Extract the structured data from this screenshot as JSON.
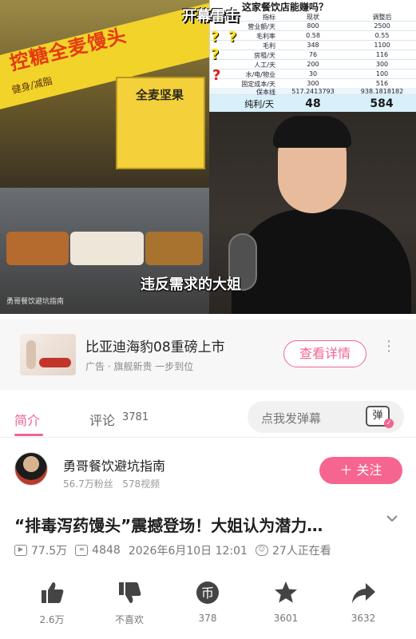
{
  "video": {
    "headline": "开幕雷击",
    "subtitle": "违反需求的大姐",
    "shop_title": "控糖全麦馒头",
    "shop_sub": "健身/减脂",
    "shop_board": "全麦坚果",
    "watermark": "勇哥餐饮避坑指南",
    "table": {
      "title": "这家餐饮店能赚吗？",
      "header": [
        "指标",
        "现状",
        "调整后"
      ],
      "rows": [
        [
          "营业额/天",
          "800",
          "2500"
        ],
        [
          "毛利率",
          "0.58",
          "0.55"
        ],
        [
          "毛利",
          "348",
          "1100"
        ],
        [
          "房租/天",
          "76",
          "116"
        ],
        [
          "人工/天",
          "200",
          "300"
        ],
        [
          "水/电/物业",
          "30",
          "100"
        ],
        [
          "固定成本/天",
          "300",
          "516"
        ],
        [
          "保本线",
          "517.2413793",
          "938.1818182"
        ]
      ],
      "result": [
        "纯利/天",
        "48",
        "584"
      ]
    },
    "question_marks": [
      "?",
      "?",
      "?",
      "?"
    ]
  },
  "ad": {
    "title": "比亚迪海豹08重磅上市",
    "sub": "广告 · 旗舰新贵 一步到位",
    "button": "查看详情",
    "more": "⋮"
  },
  "tabs": {
    "intro": "简介",
    "comments": "评论",
    "comment_count": "3781",
    "danmu_placeholder": "点我发弹幕",
    "danmu_icon_label": "弹"
  },
  "author": {
    "name": "勇哥餐饮避坑指南",
    "fans": "56.7万粉丝",
    "videos": "578视频",
    "follow": "＋ 关注"
  },
  "title": "“排毒泻药馒头”震撼登场！大姐认为潜力…",
  "meta": {
    "plays": "77.5万",
    "danmaku": "4848",
    "date": "2026年6月10日 12:01",
    "watching": "27人正在看"
  },
  "actions": [
    {
      "name": "like",
      "label": "2.6万"
    },
    {
      "name": "dislike",
      "label": "不喜欢"
    },
    {
      "name": "coin",
      "label": "378"
    },
    {
      "name": "favorite",
      "label": "3601"
    },
    {
      "name": "share",
      "label": "3632"
    }
  ],
  "colors": {
    "accent": "#f0658f",
    "text": "#222222",
    "muted": "#888888"
  }
}
